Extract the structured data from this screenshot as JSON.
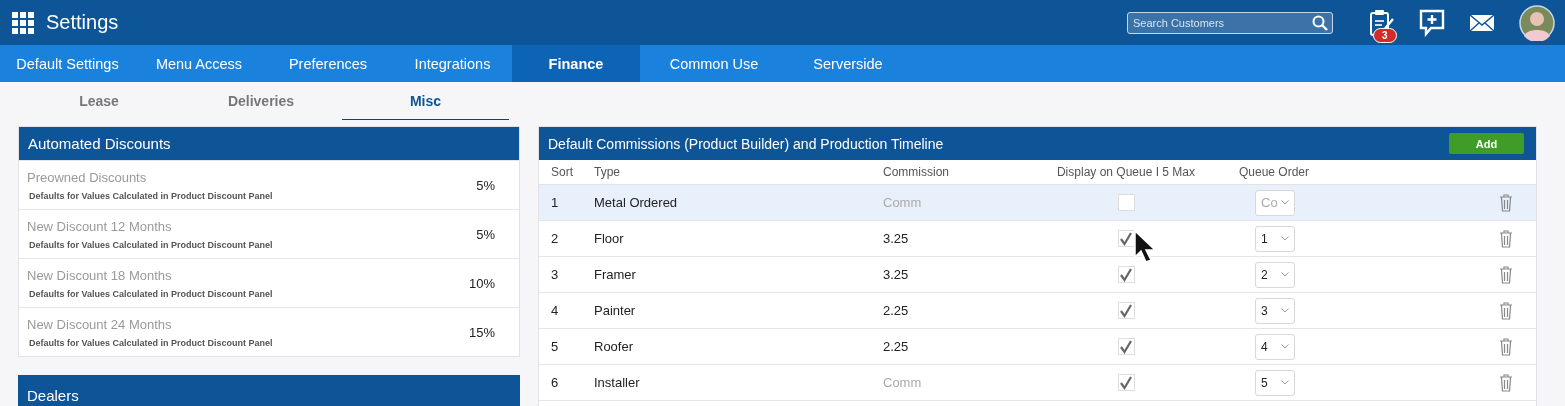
{
  "header": {
    "title": "Settings",
    "search": {
      "placeholder": "Search Customers"
    },
    "task_badge": "3"
  },
  "nav_tabs": [
    {
      "label": "Default Settings",
      "selected": false
    },
    {
      "label": "Menu Access",
      "selected": false
    },
    {
      "label": "Preferences",
      "selected": false
    },
    {
      "label": "Integrations",
      "selected": false
    },
    {
      "label": "Finance",
      "selected": true
    },
    {
      "label": "Common Use",
      "selected": false
    },
    {
      "label": "Serverside",
      "selected": false
    }
  ],
  "sub_tabs": [
    {
      "label": "Lease",
      "selected": false
    },
    {
      "label": "Deliveries",
      "selected": false
    },
    {
      "label": "Misc",
      "selected": true
    }
  ],
  "automated_discounts": {
    "title": "Automated Discounts",
    "items": [
      {
        "name": "Preowned Discounts",
        "note": "Defaults for Values Calculated in Product Discount Panel",
        "value": "5%"
      },
      {
        "name": "New Discount 12 Months",
        "note": "Defaults for Values Calculated in Product Discount Panel",
        "value": "5%"
      },
      {
        "name": "New Discount 18 Months",
        "note": "Defaults for Values Calculated in Product Discount Panel",
        "value": "10%"
      },
      {
        "name": "New Discount 24 Months",
        "note": "Defaults for Values Calculated in Product Discount Panel",
        "value": "15%"
      }
    ]
  },
  "dealers": {
    "title": "Dealers"
  },
  "commissions": {
    "title": "Default Commissions (Product Builder) and Production Timeline",
    "add_button": "Add",
    "columns": [
      "Sort",
      "Type",
      "Commission",
      "Display on Queue I 5 Max",
      "Queue Order"
    ],
    "rows": [
      {
        "sort": "1",
        "type": "Metal Ordered",
        "commission": {
          "placeholder": "Comm"
        },
        "display_on_queue": false,
        "queue_order": {
          "placeholder": "Co"
        },
        "selected": true
      },
      {
        "sort": "2",
        "type": "Floor",
        "commission": {
          "value": "3.25"
        },
        "display_on_queue": true,
        "queue_order": {
          "value": "1"
        },
        "selected": false
      },
      {
        "sort": "3",
        "type": "Framer",
        "commission": {
          "value": "3.25"
        },
        "display_on_queue": true,
        "queue_order": {
          "value": "2"
        },
        "selected": false
      },
      {
        "sort": "4",
        "type": "Painter",
        "commission": {
          "value": "2.25"
        },
        "display_on_queue": true,
        "queue_order": {
          "value": "3"
        },
        "selected": false
      },
      {
        "sort": "5",
        "type": "Roofer",
        "commission": {
          "value": "2.25"
        },
        "display_on_queue": true,
        "queue_order": {
          "value": "4"
        },
        "selected": false
      },
      {
        "sort": "6",
        "type": "Installer",
        "commission": {
          "placeholder": "Comm"
        },
        "display_on_queue": true,
        "queue_order": {
          "value": "5"
        },
        "selected": false
      }
    ]
  }
}
